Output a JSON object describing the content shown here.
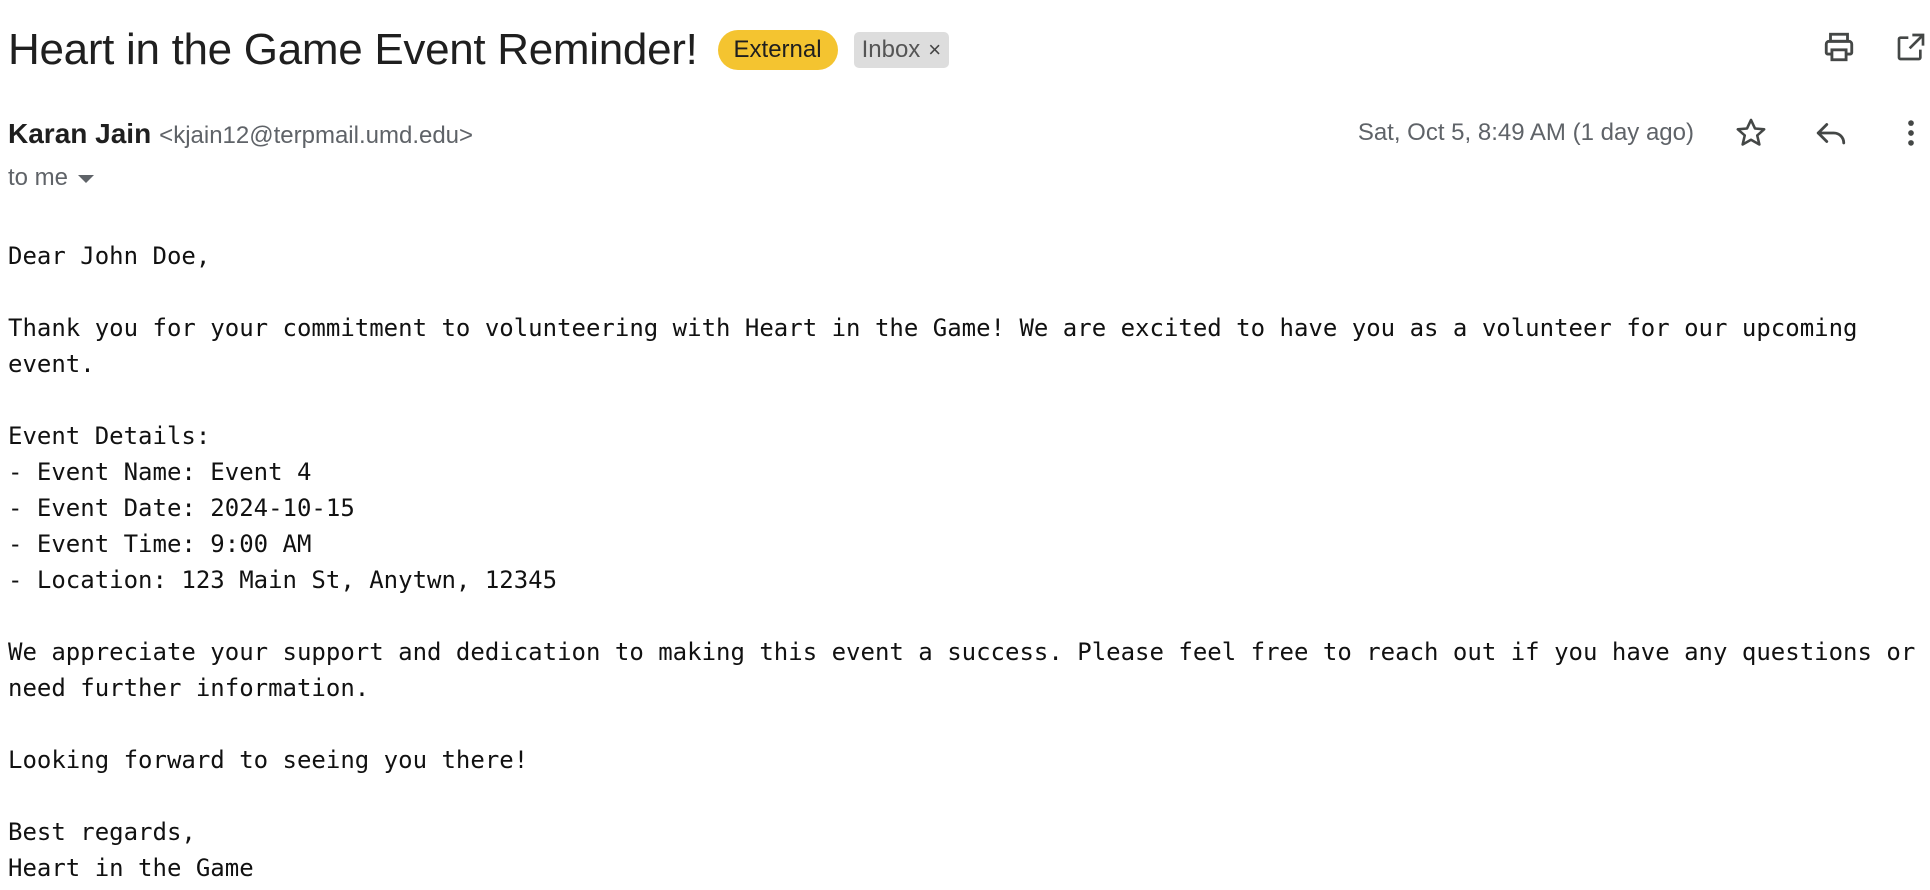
{
  "header": {
    "subject": "Heart in the Game Event Reminder!",
    "labels": {
      "external": "External",
      "inbox": "Inbox",
      "inbox_close": "×"
    }
  },
  "sender": {
    "name": "Karan Jain",
    "email": "<kjain12@terpmail.umd.edu>",
    "to": "to me",
    "date": "Sat, Oct 5, 8:49 AM (1 day ago)"
  },
  "icons": {
    "print": "printer-icon",
    "open_new": "open-in-new-window-icon",
    "star": "star-icon",
    "reply": "reply-icon",
    "more": "more-vertical-icon"
  },
  "body": {
    "greeting": "Dear John Doe,",
    "para1_line1": "Thank you for your commitment to volunteering with Heart in the Game! We are excited to have you as a volunteer for our upcoming",
    "para1_line2": "event.",
    "details_heading": "Event Details:",
    "detail_name": "- Event Name: Event 4",
    "detail_date": "- Event Date: 2024-10-15",
    "detail_time": "- Event Time: 9:00 AM",
    "detail_location": "- Location: 123 Main St, Anytwn, 12345",
    "para2_line1": "We appreciate your support and dedication to making this event a success. Please feel free to reach out if you have any questions or",
    "para2_line2": "need further information.",
    "closing_line": "Looking forward to seeing you there!",
    "sign_off": "Best regards,",
    "signature": "Heart in the Game"
  },
  "colors": {
    "external_label": "#f4c430",
    "inbox_label": "#dddddd",
    "text_primary": "#1f1f1f",
    "text_secondary": "#5f6368"
  }
}
